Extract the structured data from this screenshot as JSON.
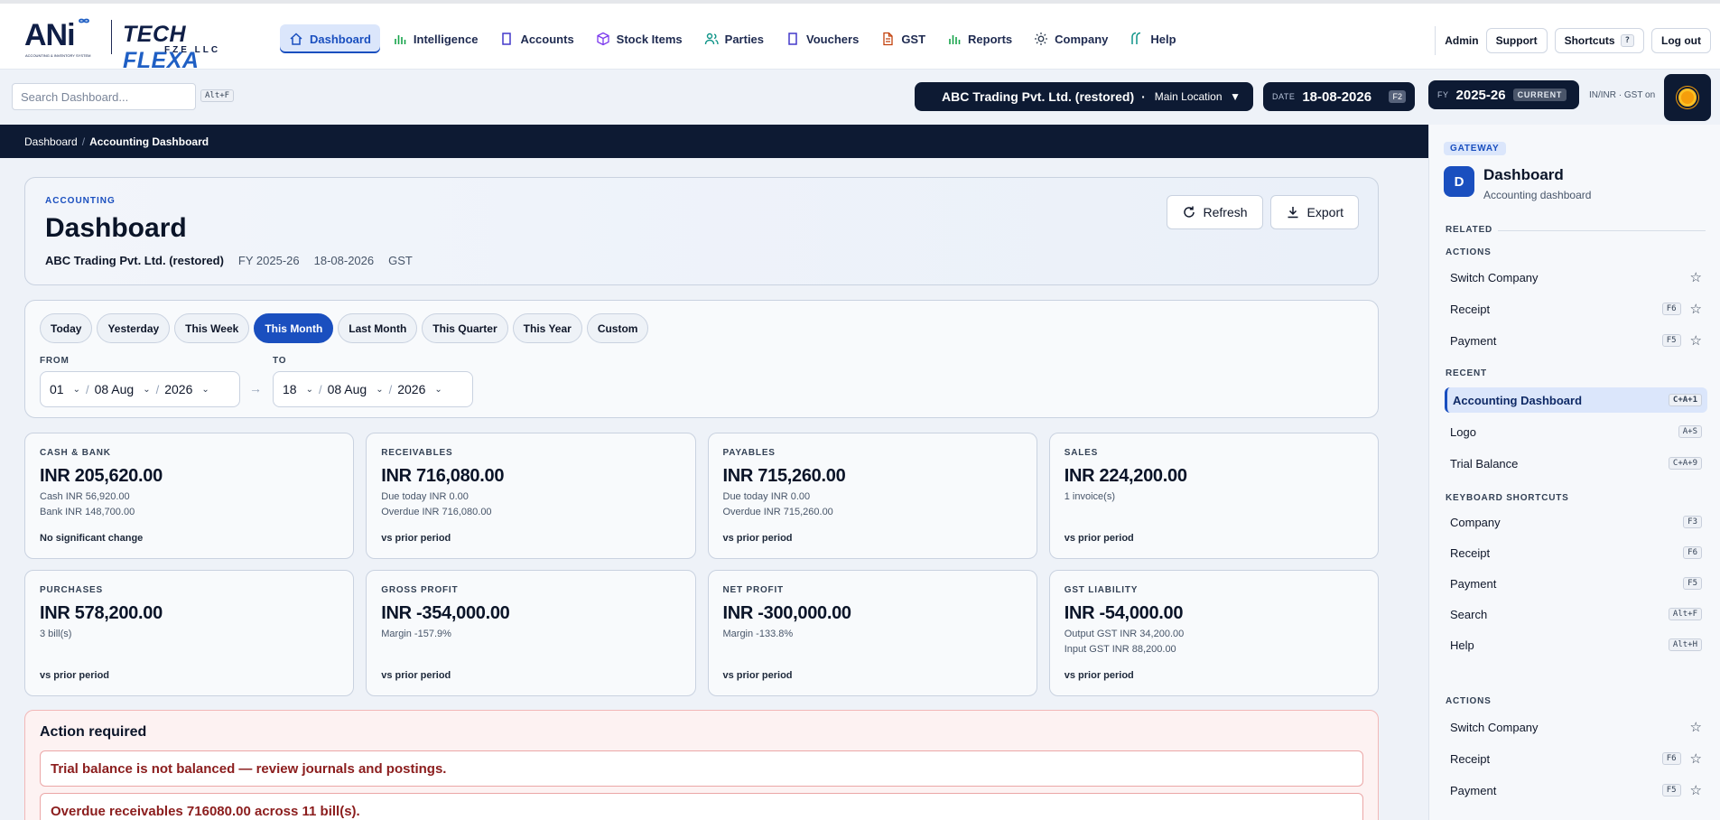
{
  "brand": {
    "ani": "ANi",
    "ani_sub": "ACCOUNTING & INVENTORY SYSTEM",
    "tf_a": "TECH",
    "tf_b": " FLEXA",
    "tf_sub": "FZE LLC"
  },
  "nav": [
    {
      "label": "Dashboard",
      "icon": "home-icon"
    },
    {
      "label": "Intelligence",
      "icon": "bar-chart-icon"
    },
    {
      "label": "Accounts",
      "icon": "book-icon"
    },
    {
      "label": "Stock Items",
      "icon": "cube-icon"
    },
    {
      "label": "Parties",
      "icon": "users-icon"
    },
    {
      "label": "Vouchers",
      "icon": "book-icon"
    },
    {
      "label": "GST",
      "icon": "document-icon"
    },
    {
      "label": "Reports",
      "icon": "bar-chart-icon"
    },
    {
      "label": "Company",
      "icon": "sun-icon"
    },
    {
      "label": "Help",
      "icon": "help-icon"
    }
  ],
  "top_right": {
    "user": "Admin",
    "support": "Support",
    "shortcuts": "Shortcuts",
    "shortcuts_key": "?",
    "logout": "Log out"
  },
  "search": {
    "placeholder": "Search Dashboard...",
    "key": "Alt+F"
  },
  "company": {
    "name": "ABC Trading Pvt. Ltd. (restored)",
    "separator": "·",
    "location": "Main Location",
    "caret": "▼"
  },
  "date": {
    "label": "DATE",
    "value": "18-08-2026",
    "key": "F2"
  },
  "fy": {
    "label": "FY",
    "value": "2025-26",
    "badge": "CURRENT"
  },
  "locale": "IN/INR · GST on",
  "breadcrumb": {
    "root": "Dashboard",
    "sep": "/",
    "current": "Accounting Dashboard"
  },
  "hero": {
    "kicker": "ACCOUNTING",
    "title": "Dashboard",
    "company": "ABC Trading Pvt. Ltd. (restored)",
    "fy": "FY 2025-26",
    "date": "18-08-2026",
    "tax": "GST",
    "refresh": "Refresh",
    "export": "Export"
  },
  "periods": [
    "Today",
    "Yesterday",
    "This Week",
    "This Month",
    "Last Month",
    "This Quarter",
    "This Year",
    "Custom"
  ],
  "active_period": "This Month",
  "range": {
    "from_label": "FROM",
    "to_label": "TO",
    "from_day": "01",
    "from_month": "08 Aug",
    "from_year": "2026",
    "to_day": "18",
    "to_month": "08 Aug",
    "to_year": "2026",
    "arrow": "→"
  },
  "kpis": [
    {
      "label": "CASH & BANK",
      "value": "INR 205,620.00",
      "lines": [
        "Cash INR 56,920.00",
        "Bank INR 148,700.00"
      ],
      "foot": "No significant change"
    },
    {
      "label": "RECEIVABLES",
      "value": "INR 716,080.00",
      "lines": [
        "Due today INR 0.00",
        "Overdue INR 716,080.00"
      ],
      "foot": "vs prior period"
    },
    {
      "label": "PAYABLES",
      "value": "INR 715,260.00",
      "lines": [
        "Due today INR 0.00",
        "Overdue INR 715,260.00"
      ],
      "foot": "vs prior period"
    },
    {
      "label": "SALES",
      "value": "INR 224,200.00",
      "lines": [
        "1 invoice(s)"
      ],
      "foot": "vs prior period"
    },
    {
      "label": "PURCHASES",
      "value": "INR 578,200.00",
      "lines": [
        "3 bill(s)"
      ],
      "foot": "vs prior period"
    },
    {
      "label": "GROSS PROFIT",
      "value": "INR -354,000.00",
      "lines": [
        "Margin -157.9%"
      ],
      "foot": "vs prior period"
    },
    {
      "label": "NET PROFIT",
      "value": "INR -300,000.00",
      "lines": [
        "Margin -133.8%"
      ],
      "foot": "vs prior period"
    },
    {
      "label": "GST LIABILITY",
      "value": "INR -54,000.00",
      "lines": [
        "Output GST INR 34,200.00",
        "Input GST INR 88,200.00"
      ],
      "foot": "vs prior period"
    }
  ],
  "action": {
    "title": "Action required",
    "alerts": [
      "Trial balance is not balanced — review journals and postings.",
      "Overdue receivables 716080.00 across 11 bill(s)."
    ]
  },
  "sidebar": {
    "gateway": "GATEWAY",
    "avatar": "D",
    "title": "Dashboard",
    "subtitle": "Accounting dashboard",
    "related": "RELATED",
    "actions_label": "ACTIONS",
    "recent_label": "RECENT",
    "shortcuts_label": "KEYBOARD SHORTCUTS",
    "actions": [
      {
        "label": "Switch Company",
        "key": ""
      },
      {
        "label": "Receipt",
        "key": "F6"
      },
      {
        "label": "Payment",
        "key": "F5"
      }
    ],
    "recent": [
      {
        "label": "Accounting Dashboard",
        "key": "C+A+1"
      },
      {
        "label": "Logo",
        "key": "A+S"
      },
      {
        "label": "Trial Balance",
        "key": "C+A+9"
      }
    ],
    "shortcuts": [
      {
        "label": "Company",
        "key": "F3"
      },
      {
        "label": "Receipt",
        "key": "F6"
      },
      {
        "label": "Payment",
        "key": "F5"
      },
      {
        "label": "Search",
        "key": "Alt+F"
      },
      {
        "label": "Help",
        "key": "Alt+H"
      }
    ],
    "actions2_label": "ACTIONS",
    "actions2": [
      {
        "label": "Switch Company",
        "key": ""
      },
      {
        "label": "Receipt",
        "key": "F6"
      },
      {
        "label": "Payment",
        "key": "F5"
      }
    ]
  },
  "colors": {
    "accent": "#1a4fbf",
    "navy": "#0d1a33",
    "alert": "#8b1d1d",
    "orb": "#f59e0b"
  }
}
